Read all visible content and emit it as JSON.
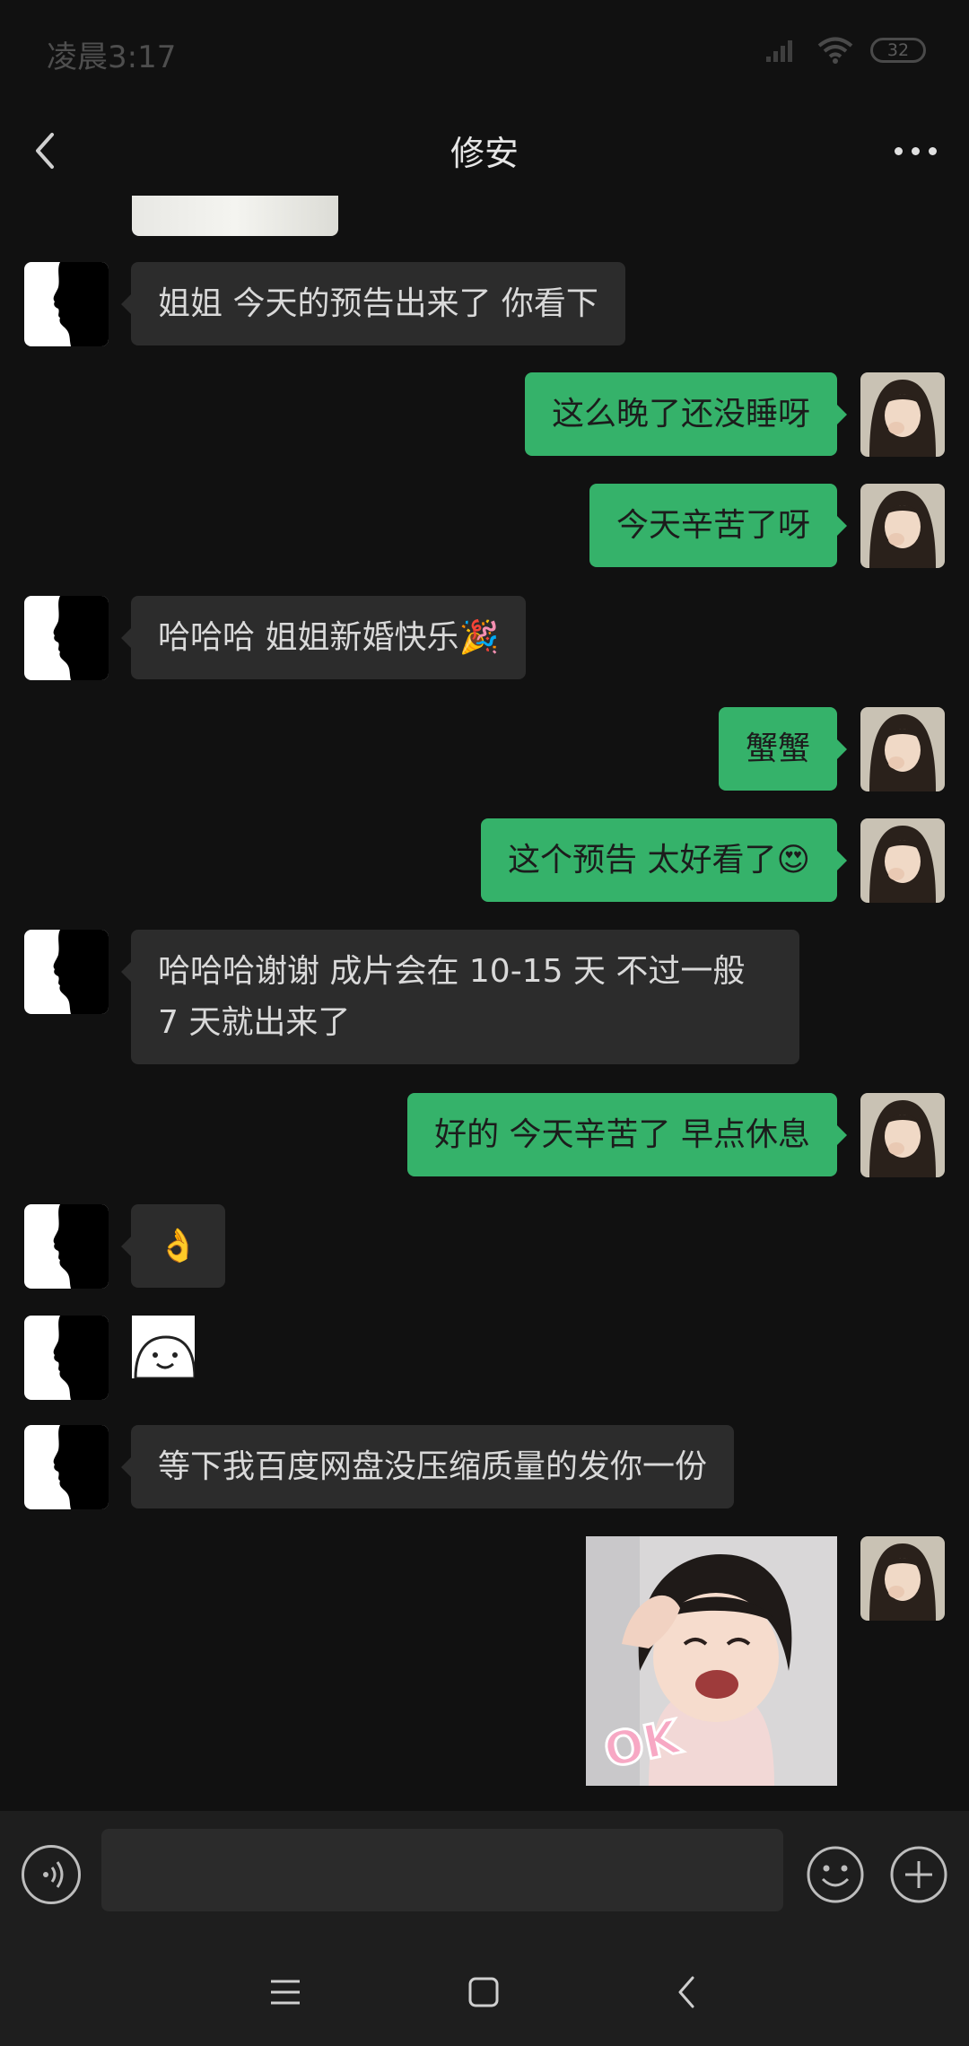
{
  "status_bar": {
    "time": "凌晨3:17",
    "battery": "32"
  },
  "header": {
    "title": "修安"
  },
  "messages": [
    {
      "side": "in",
      "text": "姐姐 今天的预告出来了 你看下"
    },
    {
      "side": "out",
      "text": "这么晚了还没睡呀"
    },
    {
      "side": "out",
      "text": "今天辛苦了呀"
    },
    {
      "side": "in",
      "text": "哈哈哈 姐姐新婚快乐🎉"
    },
    {
      "side": "out",
      "text": "蟹蟹"
    },
    {
      "side": "out",
      "text": "这个预告 太好看了😍"
    },
    {
      "side": "in",
      "text": "哈哈哈谢谢 成片会在 10-15 天 不过一般 7 天就出来了"
    },
    {
      "side": "out",
      "text": "好的 今天辛苦了 早点休息"
    },
    {
      "side": "in",
      "text": "👌"
    },
    {
      "side": "in",
      "type": "sticker",
      "sticker": "smile-face-sticker"
    },
    {
      "side": "in",
      "text": "等下我百度网盘没压缩质量的发你一份"
    },
    {
      "side": "out",
      "type": "image",
      "overlay_text": "OK"
    }
  ],
  "input": {
    "placeholder": ""
  },
  "colors": {
    "accent_green": "#35b26a",
    "incoming_bubble": "#2c2c2c",
    "background": "#111111"
  }
}
